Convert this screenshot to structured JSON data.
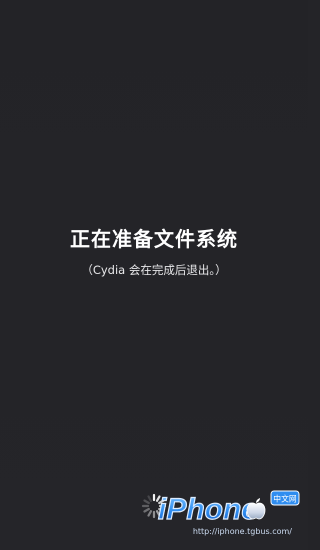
{
  "screen": {
    "title": "正在准备文件系统",
    "subtitle": "（Cydia 会在完成后退出。）"
  },
  "loading_indicator": {
    "icon": "spinner-icon"
  },
  "watermark": {
    "logo_text": "iPhone",
    "badge_text": "中文网",
    "url": "http://iphone.tgbus.com/"
  },
  "colors": {
    "background": "#242428",
    "text": "#ffffff",
    "watermark_blue": "#2f8df0"
  }
}
